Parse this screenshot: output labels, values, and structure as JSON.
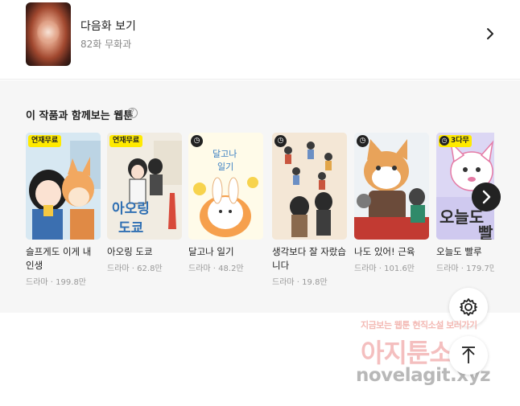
{
  "next_episode": {
    "title": "다음화 보기",
    "subtitle": "82화 무화과"
  },
  "recommend": {
    "heading": "이 작품과 함께보는 웹툰",
    "help": "?",
    "cards": [
      {
        "title": "슬프게도 이게 내 인생",
        "genre": "드라마",
        "views": "199.8만",
        "badge": "연재무료",
        "badge_type": "free"
      },
      {
        "title": "아오링 도쿄",
        "genre": "드라마",
        "views": "62.8만",
        "badge": "연재무료",
        "badge_type": "free"
      },
      {
        "title": "달고나 일기",
        "genre": "드라마",
        "views": "48.2만",
        "badge": "",
        "badge_type": "wait"
      },
      {
        "title": "생각보다 잘 자랐습니다",
        "genre": "드라마",
        "views": "19.8만",
        "badge": "",
        "badge_type": "wait"
      },
      {
        "title": "나도 있어! 근육",
        "genre": "드라마",
        "views": "101.6만",
        "badge": "",
        "badge_type": "wait"
      },
      {
        "title": "오늘도 빨루",
        "genre": "드라마",
        "views": "179.7만",
        "badge": "3다무",
        "badge_type": "wait-free"
      }
    ],
    "dot": "·"
  },
  "icons": {
    "next_ep": "chevron-right-icon",
    "help": "question-circle-icon",
    "carousel_next": "chevron-right-icon",
    "settings": "gear-icon",
    "scroll_top": "arrow-up-icon",
    "wait": "clock-icon"
  },
  "watermark": {
    "line1": "지금보는 웹툰 현직소설 보러가기",
    "line2": "아지툰소설",
    "line3": "novelagit.xyz"
  }
}
